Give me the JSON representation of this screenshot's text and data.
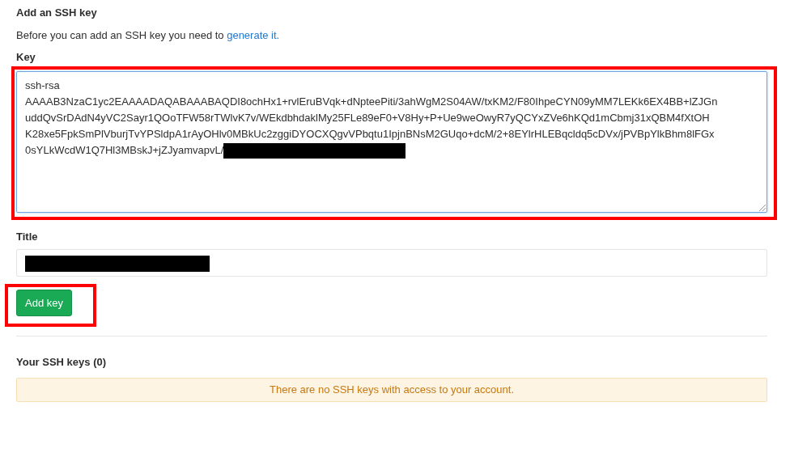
{
  "heading": "Add an SSH key",
  "intro": {
    "text": "Before you can add an SSH key you need to ",
    "link": "generate it."
  },
  "key_field": {
    "label": "Key",
    "annotated": true,
    "redacted_tail": true,
    "lines": [
      "ssh-rsa",
      "AAAAB3NzaC1yc2EAAAADAQABAAABAQDI8ochHx1+rvlEruBVqk+dNpteePiti/3ahWgM2S04AW/txKM2/F80IhpeCYN09yMM7LEKk6EX4BB+lZJGn",
      "uddQvSrDAdN4yVC2Sayr1QOoTFW58rTWlvK7v/WEkdbhdaklMy25FLe89eF0+V8Hy+P+Ue9weOwyR7yQCYxZVe6hKQd1mCbmj31xQBM4fXtOH",
      "K28xe5FpkSmPlVburjTvYPSldpA1rAyOHlv0MBkUc2zggiDYOCXQgvVPbqtu1IpjnBNsM2GUqo+dcM/2+8EYlrHLEBqcldq5cDVx/jPVBpYlkBhm8lFGx",
      "0sYLkWcdW1Q7Hl3MBskJ+jZJyamvapvL/"
    ]
  },
  "title_field": {
    "label": "Title",
    "redacted": true
  },
  "add_button": {
    "label": "Add key",
    "annotated": true
  },
  "keys_section": {
    "heading": "Your SSH keys (0)",
    "notice": "There are no SSH keys with access to your account."
  }
}
